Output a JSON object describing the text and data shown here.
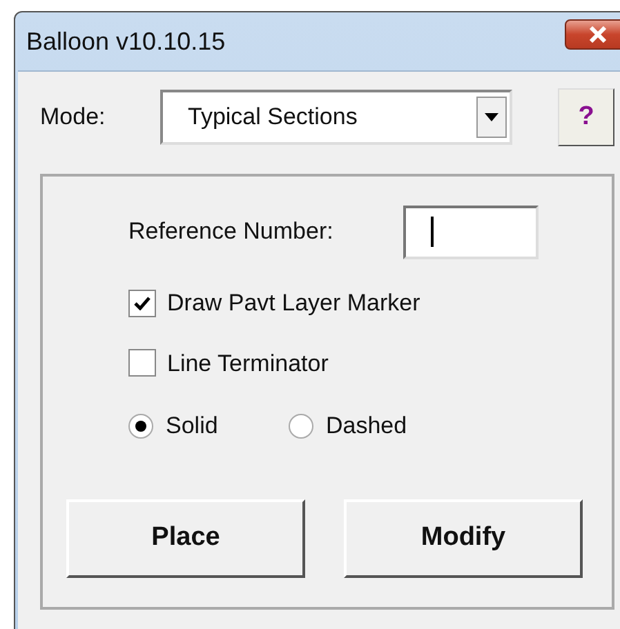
{
  "window": {
    "title": "Balloon v10.10.15"
  },
  "mode": {
    "label": "Mode:",
    "value": "Typical Sections"
  },
  "help_button": {
    "label": "?"
  },
  "reference": {
    "label": "Reference Number:",
    "focused": true
  },
  "checkboxes": [
    {
      "label": "Draw Pavt Layer Marker",
      "checked": true
    },
    {
      "label": "Line Terminator",
      "checked": false
    }
  ],
  "line_style": [
    {
      "label": "Solid",
      "selected": true
    },
    {
      "label": "Dashed",
      "selected": false
    }
  ],
  "buttons": [
    "Place",
    "Modify"
  ]
}
